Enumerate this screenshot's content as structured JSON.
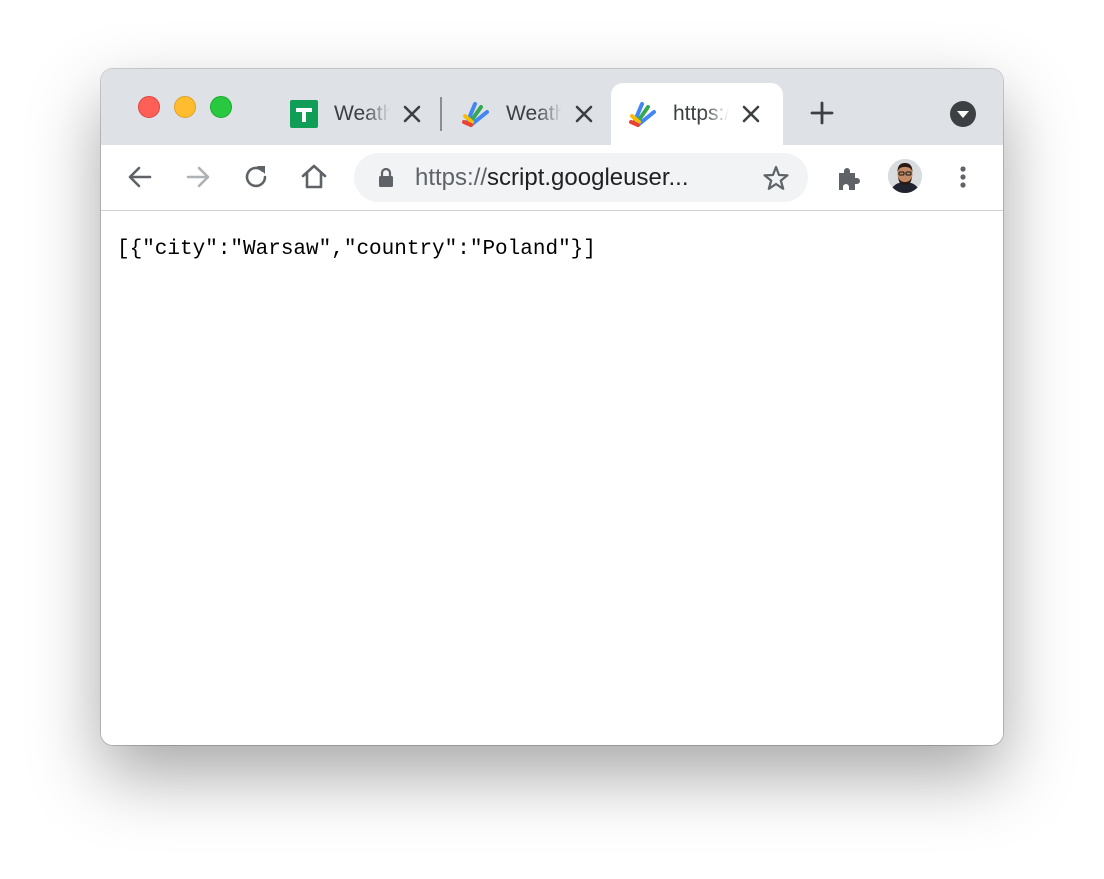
{
  "colors": {
    "tabstrip_bg": "#dee1e6",
    "close_light": "#fe5f57",
    "minimize_light": "#febc2e",
    "zoom_light": "#28c840",
    "sheets_green": "#0f9d58",
    "icon_gray": "#5f6368"
  },
  "tabs": [
    {
      "title": "Weather",
      "icon": "google-sheets-icon",
      "active": false
    },
    {
      "title": "Weather",
      "icon": "apps-script-icon",
      "active": false
    },
    {
      "title": "https://script.googleusercontent.com",
      "icon": "apps-script-icon",
      "active": true
    }
  ],
  "toolbar": {
    "url_scheme": "https://",
    "url_rest": "script.googleuser...",
    "icons": [
      "back-icon",
      "forward-icon",
      "reload-icon",
      "home-icon",
      "lock-icon",
      "star-icon",
      "extensions-icon",
      "avatar",
      "menu-icon"
    ]
  },
  "page": {
    "body_text": "[{\"city\":\"Warsaw\",\"country\":\"Poland\"}]"
  }
}
